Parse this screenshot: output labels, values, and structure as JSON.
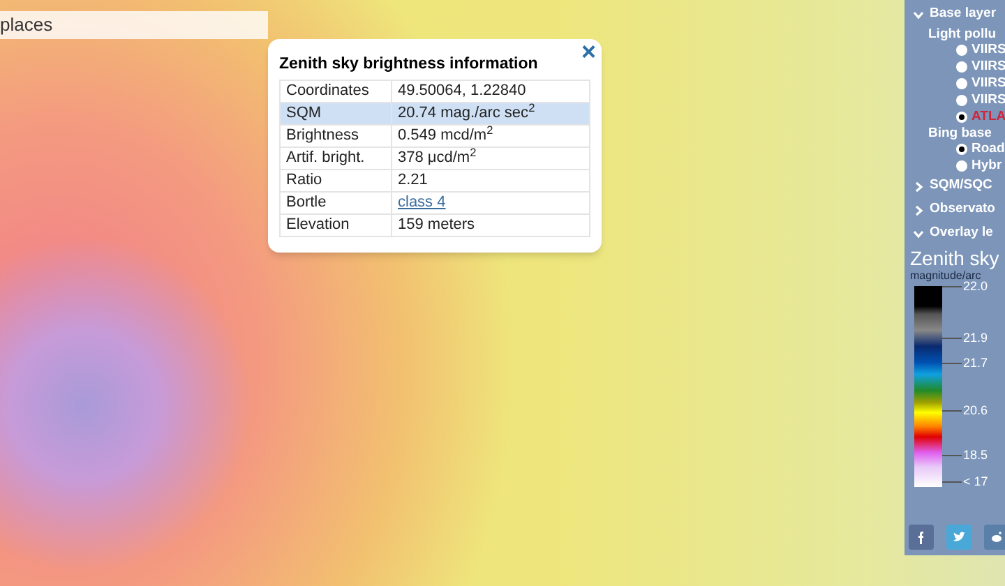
{
  "search": {
    "value": "places"
  },
  "popup": {
    "title": "Zenith sky brightness information",
    "close": "×",
    "rows": [
      {
        "label": "Coordinates",
        "value": "49.50064, 1.22840",
        "selected": false,
        "kind": "text"
      },
      {
        "label": "SQM",
        "value": "20.74 mag./arc sec$^{2}$",
        "selected": true,
        "kind": "text"
      },
      {
        "label": "Brightness",
        "value": "0.549 mcd/m$^{2}$",
        "selected": false,
        "kind": "text"
      },
      {
        "label": "Artif. bright.",
        "value": "378 μcd/m$^{2}$",
        "selected": false,
        "kind": "text"
      },
      {
        "label": "Ratio",
        "value": "2.21",
        "selected": false,
        "kind": "text"
      },
      {
        "label": "Bortle",
        "value": "class 4",
        "selected": false,
        "kind": "link"
      },
      {
        "label": "Elevation",
        "value": "159 meters",
        "selected": false,
        "kind": "text"
      }
    ]
  },
  "panel": {
    "sections": [
      {
        "label": "Base layer",
        "expanded": true,
        "groups": [
          {
            "label": "Light pollu",
            "options": [
              {
                "label": "VIIRS",
                "selected": false
              },
              {
                "label": "VIIRS",
                "selected": false
              },
              {
                "label": "VIIRS",
                "selected": false
              },
              {
                "label": "VIIRS",
                "selected": false
              },
              {
                "label": "ATLA",
                "selected": true
              }
            ]
          },
          {
            "label": "Bing base",
            "options": [
              {
                "label": "Road",
                "selected": true
              },
              {
                "label": "Hybr",
                "selected": false
              }
            ]
          }
        ]
      },
      {
        "label": "SQM/SQC",
        "expanded": false
      },
      {
        "label": "Observato",
        "expanded": false
      },
      {
        "label": "Overlay le",
        "expanded": true
      }
    ],
    "legend": {
      "title": "Zenith sky",
      "subtitle": "magnitude/arc",
      "ticks": [
        "22.0",
        "21.9",
        "21.7",
        "20.6",
        "18.5",
        "< 17"
      ]
    }
  },
  "share": [
    {
      "kind": "facebook"
    },
    {
      "kind": "twitter"
    },
    {
      "kind": "reddit"
    }
  ]
}
